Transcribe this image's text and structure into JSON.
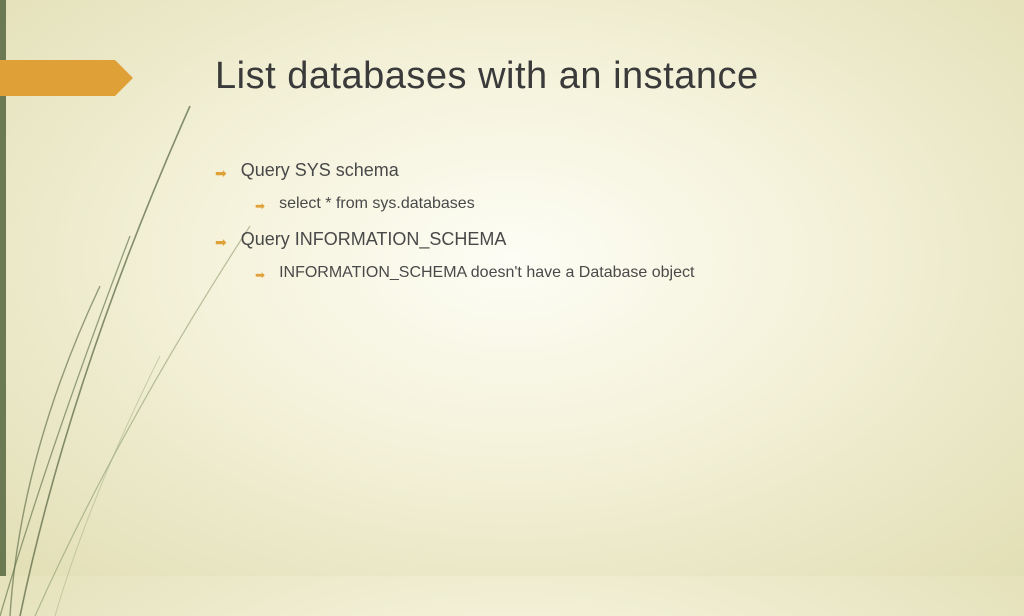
{
  "title": "List databases with an instance",
  "bullets": {
    "b1": "Query SYS schema",
    "b1a": "select * from sys.databases",
    "b2": "Query INFORMATION_SCHEMA",
    "b2a": "INFORMATION_SCHEMA doesn't have a Database object"
  }
}
